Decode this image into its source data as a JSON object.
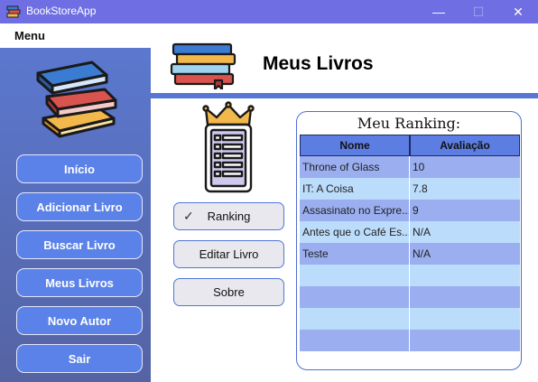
{
  "window": {
    "title": "BookStoreApp",
    "min_glyph": "—",
    "max_glyph": "☐",
    "close_glyph": "✕"
  },
  "menu": {
    "label": "Menu"
  },
  "sidebar": {
    "items": [
      {
        "label": "Início"
      },
      {
        "label": "Adicionar Livro"
      },
      {
        "label": "Buscar Livro"
      },
      {
        "label": "Meus Livros"
      },
      {
        "label": "Novo Autor"
      },
      {
        "label": "Sair"
      }
    ]
  },
  "page": {
    "title": "Meus Livros"
  },
  "actions": {
    "ranking": "Ranking",
    "ranking_check": "✓",
    "edit": "Editar Livro",
    "about": "Sobre"
  },
  "ranking": {
    "title": "Meu Ranking:",
    "columns": [
      "Nome",
      "Avaliação"
    ],
    "rows": [
      [
        "Throne of Glass",
        "10"
      ],
      [
        "IT: A Coisa",
        "7.8"
      ],
      [
        "Assasinato no Expre...",
        "9"
      ],
      [
        "Antes que o Café Es...",
        "N/A"
      ],
      [
        "Teste",
        "N/A"
      ],
      [
        "",
        ""
      ],
      [
        "",
        ""
      ],
      [
        "",
        ""
      ],
      [
        "",
        ""
      ]
    ]
  },
  "colors": {
    "titlebar": "#6f6fe3",
    "sidebar_top": "#5b78cf",
    "sidebar_bottom": "#5563a3",
    "sidebar_button": "#5b82e8",
    "accent_rule": "#5576d4",
    "grid_header": "#5c7ee2",
    "grid_row_a": "#9aaef0",
    "grid_row_b": "#bcdcfb"
  },
  "icons": {
    "app": "books-icon",
    "sidebar_logo": "books-stack-icon",
    "header_logo": "bookshelf-icon",
    "ranking_art": "crown-list-icon"
  }
}
